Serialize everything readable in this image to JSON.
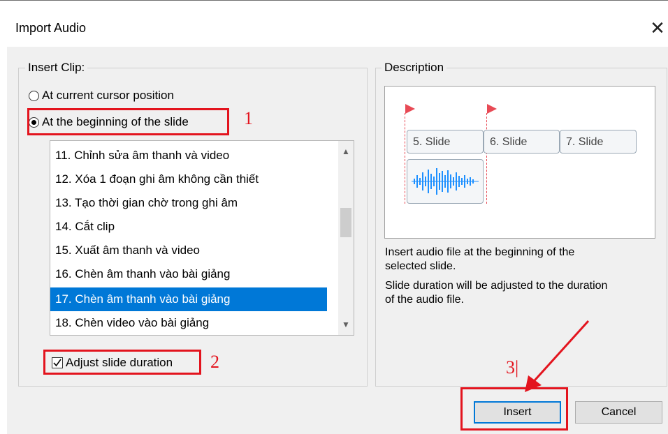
{
  "window": {
    "title": "Import Audio",
    "close_icon": "close-icon"
  },
  "insert_clip": {
    "legend": "Insert Clip:",
    "options": [
      {
        "label": "At current cursor position",
        "selected": false
      },
      {
        "label": "At the beginning of the slide",
        "selected": true
      }
    ],
    "list_items": [
      "11. Chỉnh sửa âm thanh và video",
      "12. Xóa 1 đoạn ghi âm không cần thiết",
      "13. Tạo thời gian chờ trong ghi âm",
      "14. Cắt clip",
      "15. Xuất âm thanh và video",
      "16. Chèn âm thanh vào bài giảng",
      "17. Chèn âm thanh vào bài giảng",
      "18. Chèn video vào bài giảng"
    ],
    "selected_index": 6,
    "adjust_label": "Adjust slide duration",
    "adjust_checked": true
  },
  "description": {
    "legend": "Description",
    "preview_slides": [
      "5. Slide",
      "6. Slide",
      "7. Slide"
    ],
    "text_lines": [
      "Insert audio file at the beginning of the",
      "selected slide.",
      "Slide duration will be adjusted to the duration",
      "of the audio file."
    ]
  },
  "annotations": {
    "step1": "1",
    "step2": "2",
    "step3": "3|"
  },
  "buttons": {
    "insert": "Insert",
    "cancel": "Cancel"
  },
  "colors": {
    "annotation_red": "#e3141e",
    "selection_blue": "#0078d7",
    "marker_red": "#e84a55",
    "waveform_blue": "#1e90ff"
  }
}
